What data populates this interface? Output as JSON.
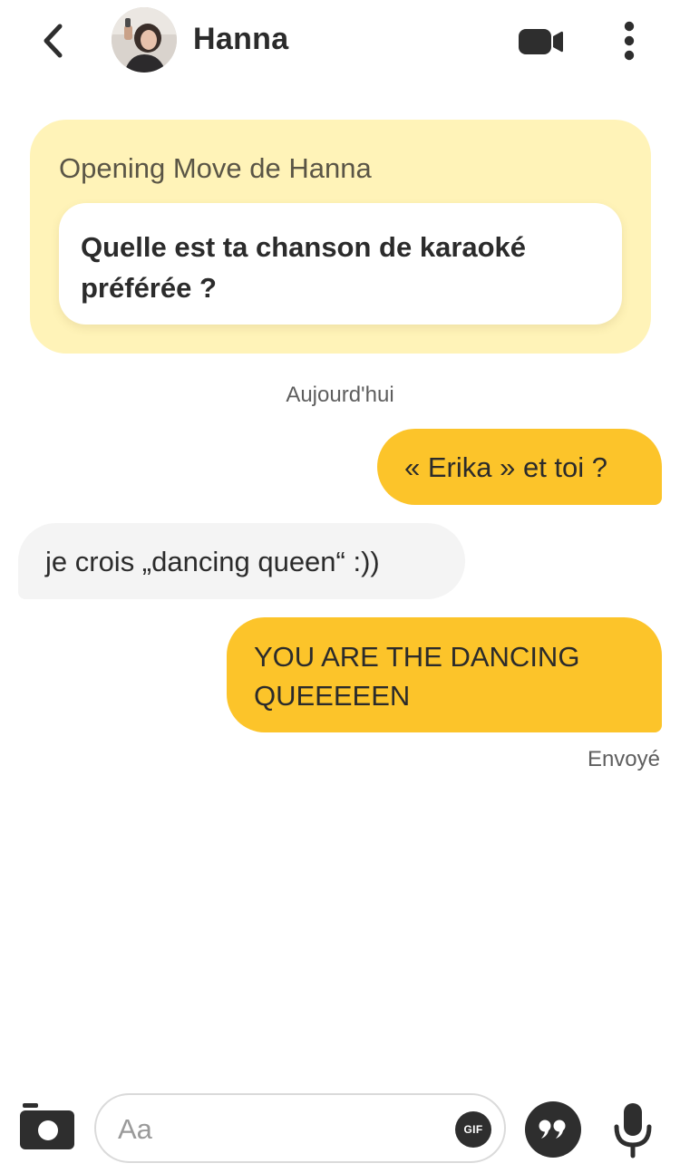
{
  "header": {
    "back_icon": "chevron-left-icon",
    "contact_name": "Hanna",
    "video_icon": "video-camera-icon",
    "more_icon": "vertical-dots-icon"
  },
  "opening_move": {
    "title": "Opening Move de Hanna",
    "question": "Quelle est ta chanson de karaoké préférée ?"
  },
  "conversation": {
    "date_label": "Aujourd'hui",
    "messages": [
      {
        "direction": "sent",
        "text": "« Erika » et toi ?"
      },
      {
        "direction": "received",
        "text": "je crois „dancing queen“ :))"
      },
      {
        "direction": "sent",
        "text": "YOU ARE THE DANCING QUEEEEEN"
      }
    ],
    "status": "Envoyé"
  },
  "composer": {
    "camera_icon": "camera-icon",
    "placeholder": "Aa",
    "gif_label": "GIF",
    "quote_icon": "quote-icon",
    "mic_icon": "microphone-icon"
  },
  "colors": {
    "sent_bubble": "#fcc42a",
    "received_bubble": "#f4f4f4",
    "opening_card": "#fff3b8",
    "dark_icon": "#2e2e2e"
  }
}
